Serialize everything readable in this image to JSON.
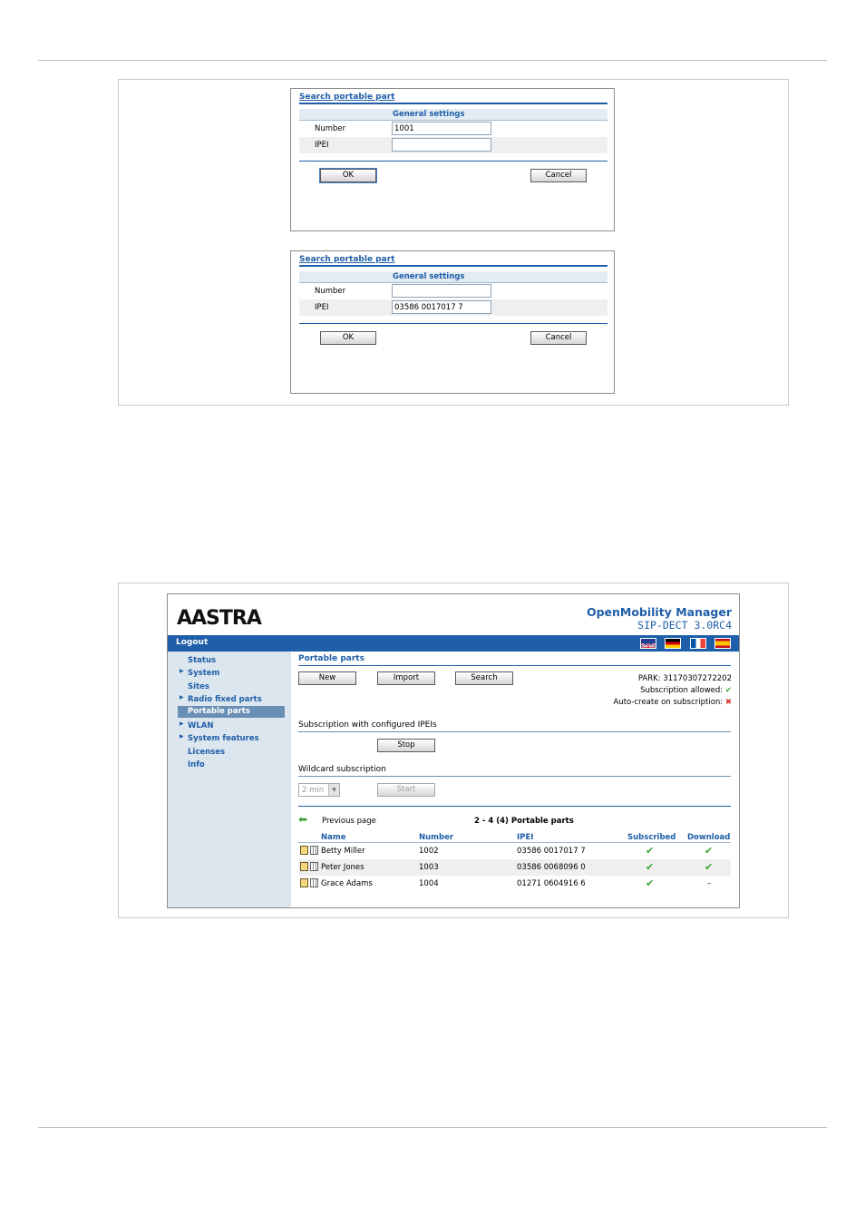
{
  "dialog1": {
    "title": "Search portable part",
    "section": "General settings",
    "number_label": "Number",
    "number_value": "1001",
    "ipei_label": "IPEI",
    "ipei_value": "",
    "ok_label": "OK",
    "cancel_label": "Cancel"
  },
  "dialog2": {
    "title": "Search portable part",
    "section": "General settings",
    "number_label": "Number",
    "number_value": "",
    "ipei_label": "IPEI",
    "ipei_value": "03586 0017017 7",
    "ok_label": "OK",
    "cancel_label": "Cancel"
  },
  "omm": {
    "logo": "AASTRA",
    "product_name": "OpenMobility Manager",
    "product_version": "SIP-DECT 3.0RC4",
    "logout_label": "Logout",
    "flags": [
      "uk-flag",
      "german-flag",
      "french-flag",
      "spanish-flag"
    ],
    "nav": [
      {
        "label": "Status",
        "expandable": false
      },
      {
        "label": "System",
        "expandable": true
      },
      {
        "label": "Sites",
        "expandable": false
      },
      {
        "label": "Radio fixed parts",
        "expandable": true
      },
      {
        "label": "Portable parts",
        "expandable": false,
        "active": true
      },
      {
        "label": "WLAN",
        "expandable": true
      },
      {
        "label": "System features",
        "expandable": true
      },
      {
        "label": "Licenses",
        "expandable": false
      },
      {
        "label": "Info",
        "expandable": false
      }
    ],
    "page_title": "Portable parts",
    "buttons": {
      "new": "New",
      "import": "Import",
      "search": "Search",
      "stop": "Stop",
      "start": "Start"
    },
    "park": "PARK: 31170307272202",
    "subscription_allowed": "Subscription allowed:",
    "auto_create": "Auto-create on subscription:",
    "subscription_configured": "Subscription with configured IPEIs",
    "wildcard_subscription": "Wildcard subscription",
    "wildcard_time": "2 min",
    "previous_page": "Previous page",
    "range": "2 - 4 (4) Portable parts",
    "table": {
      "headers": {
        "name": "Name",
        "number": "Number",
        "ipei": "IPEI",
        "subscribed": "Subscribed",
        "download": "Download"
      },
      "rows": [
        {
          "name": "Betty Miller",
          "number": "1002",
          "ipei": "03586 0017017 7",
          "subscribed": "✔",
          "download": "✔"
        },
        {
          "name": "Peter Jones",
          "number": "1003",
          "ipei": "03586 0068096 0",
          "subscribed": "✔",
          "download": "✔"
        },
        {
          "name": "Grace Adams",
          "number": "1004",
          "ipei": "01271 0604916 6",
          "subscribed": "✔",
          "download": "–"
        }
      ]
    },
    "colors": {
      "accent": "#1f5ea8",
      "sidebar": "#dce6ee",
      "active_nav": "#6a8fb4",
      "check": "#3aa336",
      "cross": "#d9302b"
    }
  }
}
